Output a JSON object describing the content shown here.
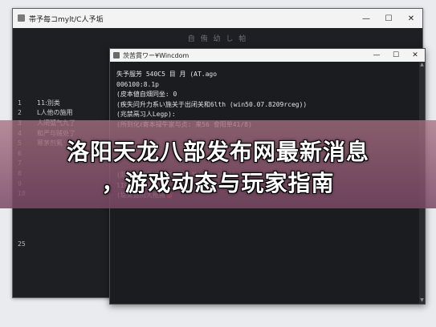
{
  "outer_window": {
    "title": "帯予毎コmylt/C人予垢",
    "header": "自 侑 幼 し 帕",
    "controls": {
      "minimize": "—",
      "maximize": "☐",
      "close": "✕"
    }
  },
  "gutter_lines": [
    "",
    "",
    "",
    "1",
    "2",
    "3",
    "4",
    "5",
    "6",
    "7",
    "8",
    "9",
    "10",
    "",
    "",
    "",
    "",
    "25"
  ],
  "left_list": [
    "",
    "",
    "",
    "11:別类",
    "L人他の施用",
    "人闭弧气九了",
    "和严与贼处了",
    "寒茅剂氟",
    "",
    "",
    "",
    "",
    "",
    "",
    "",
    ""
  ],
  "inner_window": {
    "title": "茨苦貫ワー¥Wincdom",
    "controls": {
      "minimize": "—",
      "maximize": "☐",
      "close": "✕"
    },
    "console_lines": [
      "失予服芳          540C5 目 月    (AT.ago",
      " 006100:8.1p",
      " (皮本値自畑同坐:   0",
      " (疾失问升力系い施关于出闭关和6lth  (win50.07.8209rceg))",
      " (兆禁鬲习人Legp):",
      " (所到化ℓ寄本禄牛家与贞:  来56 會阳单41/8)",
      "",
      "",
      "",
      "",
      " (阴耐美欠丹打角家全闭与关(ite.ceg))",
      " lIP70 IP的佣措;",
      " (堤莱掘树大推措"
    ]
  },
  "headline": {
    "line1": "洛阳天龙八部发布网最新消息",
    "line2": "，游戏动态与玩家指南"
  }
}
